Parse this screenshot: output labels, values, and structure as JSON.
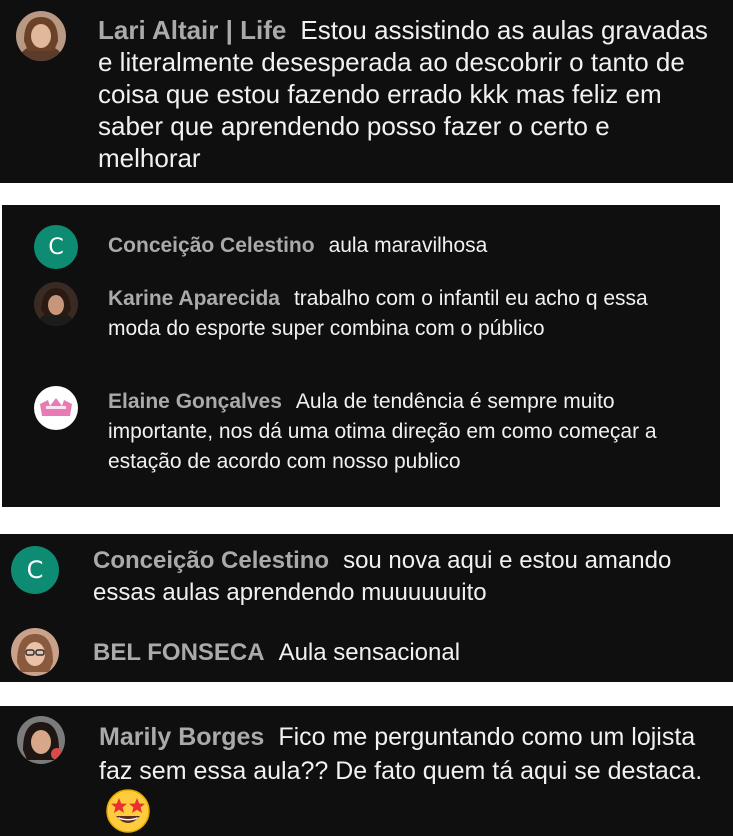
{
  "threads": [
    {
      "comments": [
        {
          "author": "Lari Altair | Life",
          "avatar": "photo",
          "text": "Estou assistindo as aulas gravadas e literalmente desesperada ao descobrir o tanto de coisa que estou fazendo errado kkk mas feliz em saber que aprendendo posso fazer o certo e melhorar"
        }
      ]
    },
    {
      "comments": [
        {
          "author": "Conceição Celestino",
          "avatar": "letter",
          "avatar_letter": "C",
          "avatar_color": "#0e8c73",
          "text": "aula maravilhosa"
        },
        {
          "author": "Karine Aparecida",
          "avatar": "photo",
          "text": "trabalho com o infantil eu acho q essa moda do esporte super combina com o público"
        },
        {
          "author": "Elaine Gonçalves",
          "avatar": "logo",
          "text": "Aula de tendência é sempre muito importante, nos dá uma otima direção em como começar a estação de acordo com nosso publico"
        }
      ]
    },
    {
      "comments": [
        {
          "author": "Conceição Celestino",
          "avatar": "letter",
          "avatar_letter": "C",
          "avatar_color": "#0e8c73",
          "text": "sou nova aqui e estou amando essas aulas aprendendo muuuuuuito"
        },
        {
          "author": "BEL FONSECA",
          "avatar": "photo",
          "text": "Aula sensacional"
        }
      ]
    },
    {
      "comments": [
        {
          "author": "Marily Borges",
          "avatar": "photo",
          "text": "Fico me perguntando como um lojista faz sem essa aula?? De fato quem tá aqui se destaca.",
          "emoji": "star-struck-emoji"
        }
      ]
    }
  ]
}
